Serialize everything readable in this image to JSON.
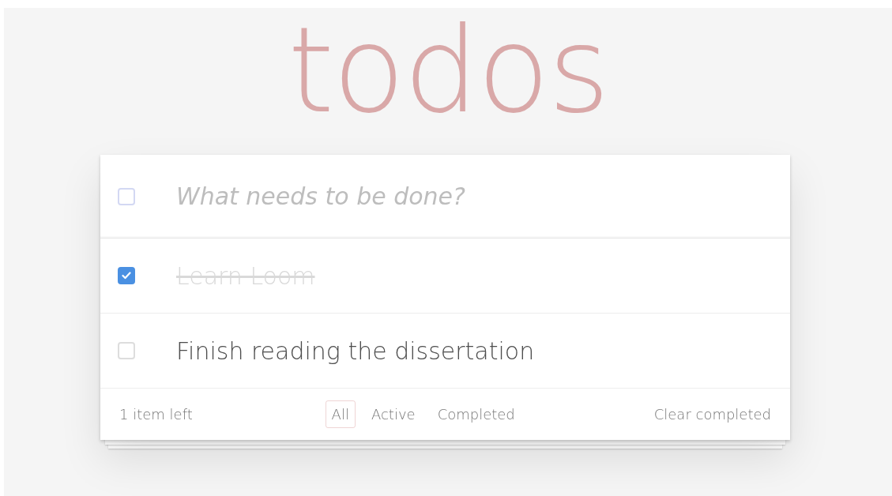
{
  "title": "todos",
  "new_todo": {
    "placeholder": "What needs to be done?",
    "toggle_all": {
      "checked": false
    }
  },
  "todos": [
    {
      "text": "Learn Loom",
      "completed": true
    },
    {
      "text": "Finish reading the dissertation",
      "completed": false
    }
  ],
  "footer": {
    "count": "1 item left",
    "filters": [
      {
        "label": "All",
        "selected": true
      },
      {
        "label": "Active",
        "selected": false
      },
      {
        "label": "Completed",
        "selected": false
      }
    ],
    "clear": "Clear completed"
  }
}
